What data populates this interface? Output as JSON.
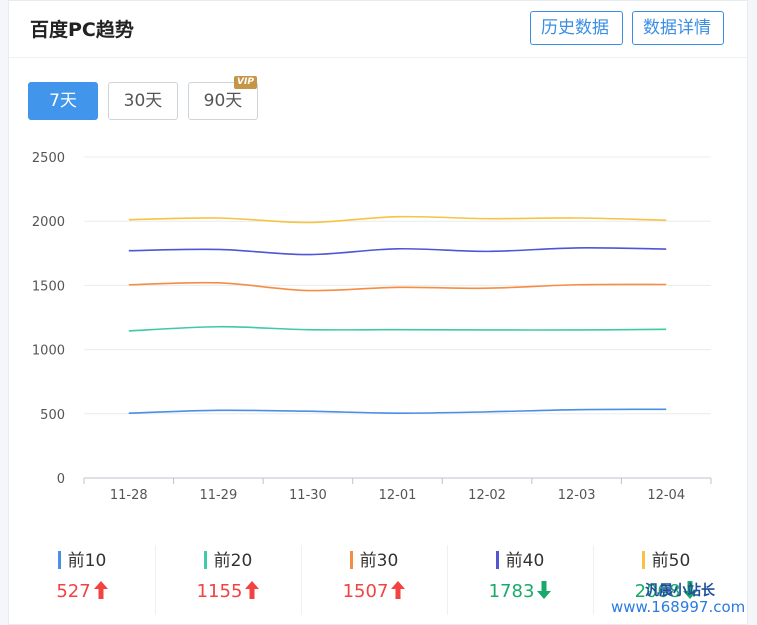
{
  "header": {
    "title": "百度PC趋势",
    "history_button": "历史数据",
    "detail_button": "数据详情"
  },
  "range_buttons": [
    {
      "label": "7天",
      "active": true
    },
    {
      "label": "30天",
      "active": false
    },
    {
      "label": "90天",
      "active": false,
      "badge": "VIP"
    }
  ],
  "chart_data": {
    "type": "line",
    "categories": [
      "11-28",
      "11-29",
      "11-30",
      "12-01",
      "12-02",
      "12-03",
      "12-04"
    ],
    "ylim": [
      0,
      2500
    ],
    "yticks": [
      0,
      500,
      1000,
      1500,
      2000,
      2500
    ],
    "grid": true,
    "series": [
      {
        "name": "前10",
        "color": "#4a8ee6",
        "values": [
          505,
          527,
          520,
          505,
          515,
          532,
          535
        ]
      },
      {
        "name": "前20",
        "color": "#3fcaa5",
        "values": [
          1145,
          1178,
          1155,
          1155,
          1153,
          1153,
          1158
        ]
      },
      {
        "name": "前30",
        "color": "#f58d42",
        "values": [
          1505,
          1520,
          1460,
          1485,
          1478,
          1505,
          1507
        ]
      },
      {
        "name": "前40",
        "color": "#5055d6",
        "values": [
          1770,
          1780,
          1740,
          1785,
          1765,
          1792,
          1783
        ]
      },
      {
        "name": "前50",
        "color": "#f6c344",
        "values": [
          2012,
          2025,
          1990,
          2035,
          2020,
          2025,
          2008
        ]
      }
    ]
  },
  "stats": [
    {
      "label": "前10",
      "value": "527",
      "trend": "up",
      "color": "#4a8ee6"
    },
    {
      "label": "前20",
      "value": "1155",
      "trend": "up",
      "color": "#3fcaa5"
    },
    {
      "label": "前30",
      "value": "1507",
      "trend": "up",
      "color": "#f58d42"
    },
    {
      "label": "前40",
      "value": "1783",
      "trend": "down",
      "color": "#5055d6"
    },
    {
      "label": "前50",
      "value": "2008",
      "trend": "down",
      "color": "#f6c344"
    }
  ],
  "watermark": {
    "line1": "汎晨小站长",
    "line2": "www.168997.com"
  }
}
